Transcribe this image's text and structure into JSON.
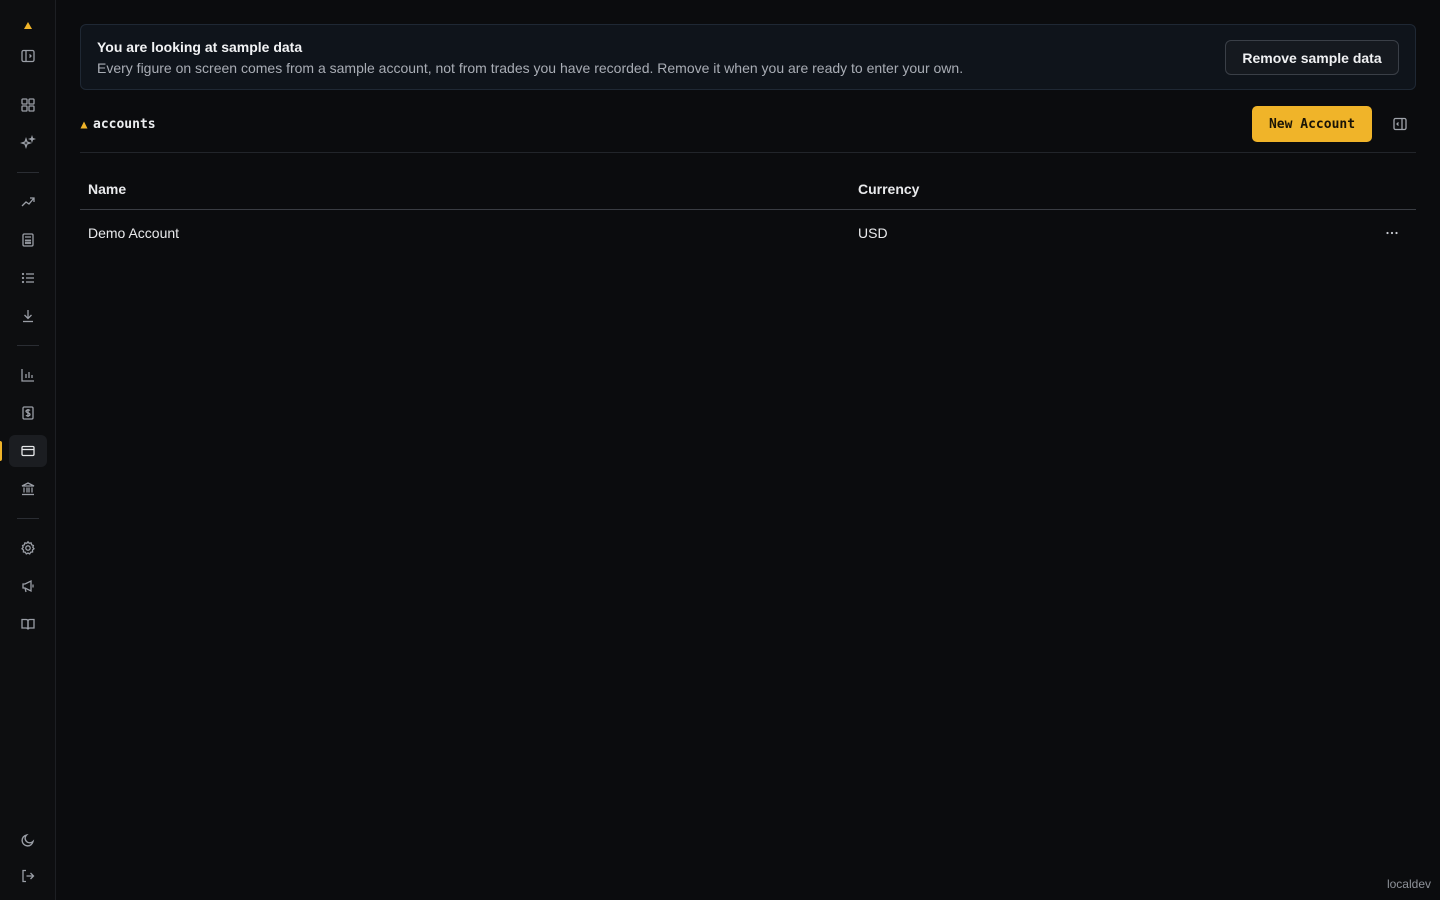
{
  "sidebar": {
    "logo_icon": "triangle-logo-icon",
    "items": [
      {
        "icon": "panel-icon"
      },
      {
        "icon": "dashboard-grid-icon"
      },
      {
        "icon": "sparkles-icon"
      },
      {
        "icon": "trending-up-icon"
      },
      {
        "icon": "calculator-icon"
      },
      {
        "icon": "list-icon"
      },
      {
        "icon": "download-icon"
      },
      {
        "icon": "bar-chart-icon"
      },
      {
        "icon": "dollar-icon"
      },
      {
        "icon": "credit-card-icon",
        "active": true
      },
      {
        "icon": "bank-icon"
      },
      {
        "icon": "settings-icon"
      },
      {
        "icon": "megaphone-icon"
      },
      {
        "icon": "book-icon"
      },
      {
        "icon": "moon-icon"
      },
      {
        "icon": "logout-icon"
      }
    ],
    "accent_color": "#f0b429"
  },
  "banner": {
    "title": "You are looking at sample data",
    "text": "Every figure on screen comes from a sample account, not from trades you have recorded. Remove it when you are ready to enter your own.",
    "button_label": "Remove sample data"
  },
  "page": {
    "breadcrumb": "accounts",
    "new_button_label": "New Account",
    "primary_color": "#f0b429"
  },
  "table": {
    "columns": [
      "Name",
      "Currency"
    ],
    "rows": [
      {
        "name": "Demo Account",
        "currency": "USD"
      }
    ],
    "row_menu_icon": "more-horizontal-icon"
  },
  "footer": {
    "environment": "localdev"
  }
}
